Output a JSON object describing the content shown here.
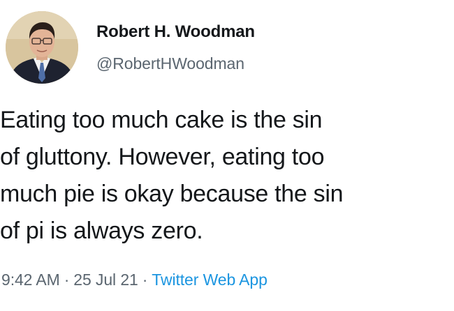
{
  "author": {
    "display_name": "Robert H. Woodman",
    "handle": "@RobertHWoodman",
    "avatar_icon": "profile-photo-icon"
  },
  "tweet": {
    "lines": [
      "Eating too much cake is the sin",
      "of gluttony. However, eating too",
      "much pie is okay because the sin",
      "of pi is always zero."
    ]
  },
  "meta": {
    "time": "9:42 AM",
    "separator": "·",
    "date": "25 Jul 21",
    "source": "Twitter Web App"
  },
  "colors": {
    "source_link": "#1b95e0",
    "secondary_text": "#5b6670",
    "primary_text": "#14171a"
  }
}
